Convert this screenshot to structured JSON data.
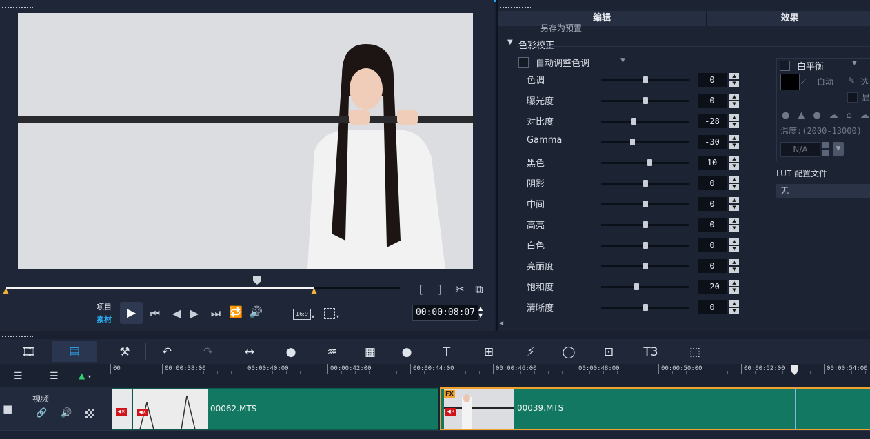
{
  "preview": {
    "mode_project": "项目",
    "mode_clip": "素材",
    "aspect": "16:9",
    "timecode": "00:00:08:07"
  },
  "panel": {
    "tabs": [
      "编辑",
      "效果"
    ],
    "save_preset_label": "另存为预置",
    "section_title": "色彩校正",
    "auto_tone_label": "自动调整色调",
    "sliders": [
      {
        "label": "色调",
        "value": "0",
        "pos": 0.5
      },
      {
        "label": "曝光度",
        "value": "0",
        "pos": 0.5
      },
      {
        "label": "对比度",
        "value": "-28",
        "pos": 0.36
      },
      {
        "label": "Gamma",
        "value": "-30",
        "pos": 0.35
      },
      {
        "label": "黑色",
        "value": "10",
        "pos": 0.55
      },
      {
        "label": "阴影",
        "value": "0",
        "pos": 0.5
      },
      {
        "label": "中间",
        "value": "0",
        "pos": 0.5
      },
      {
        "label": "高亮",
        "value": "0",
        "pos": 0.5
      },
      {
        "label": "白色",
        "value": "0",
        "pos": 0.5
      },
      {
        "label": "亮丽度",
        "value": "0",
        "pos": 0.5
      },
      {
        "label": "饱和度",
        "value": "-20",
        "pos": 0.4
      },
      {
        "label": "清晰度",
        "value": "0",
        "pos": 0.5
      }
    ],
    "white_balance_label": "白平衡",
    "auto_label": "自动",
    "pick_label": "选",
    "show_label": "显",
    "temperature_label": "温度:(2000-13000)",
    "temperature_value": "N/A",
    "lut_label": "LUT 配置文件",
    "lut_value": "无"
  },
  "timeline": {
    "ruler_ticks": [
      "00",
      "00:00:38:00",
      "00:00:40:00",
      "00:00:42:00",
      "00:00:44:00",
      "00:00:46:00",
      "00:00:48:00",
      "00:00:50:00",
      "00:00:52:00",
      "00:00:54:00"
    ],
    "track_label": "视频",
    "clips": [
      {
        "name": "00062.MTS"
      },
      {
        "name": "00039.MTS"
      }
    ],
    "fx_badge": "FX"
  },
  "colors": {
    "accent": "#1ea6f0",
    "clip_green": "#127862",
    "selected_clip_border": "#f2a12c"
  }
}
